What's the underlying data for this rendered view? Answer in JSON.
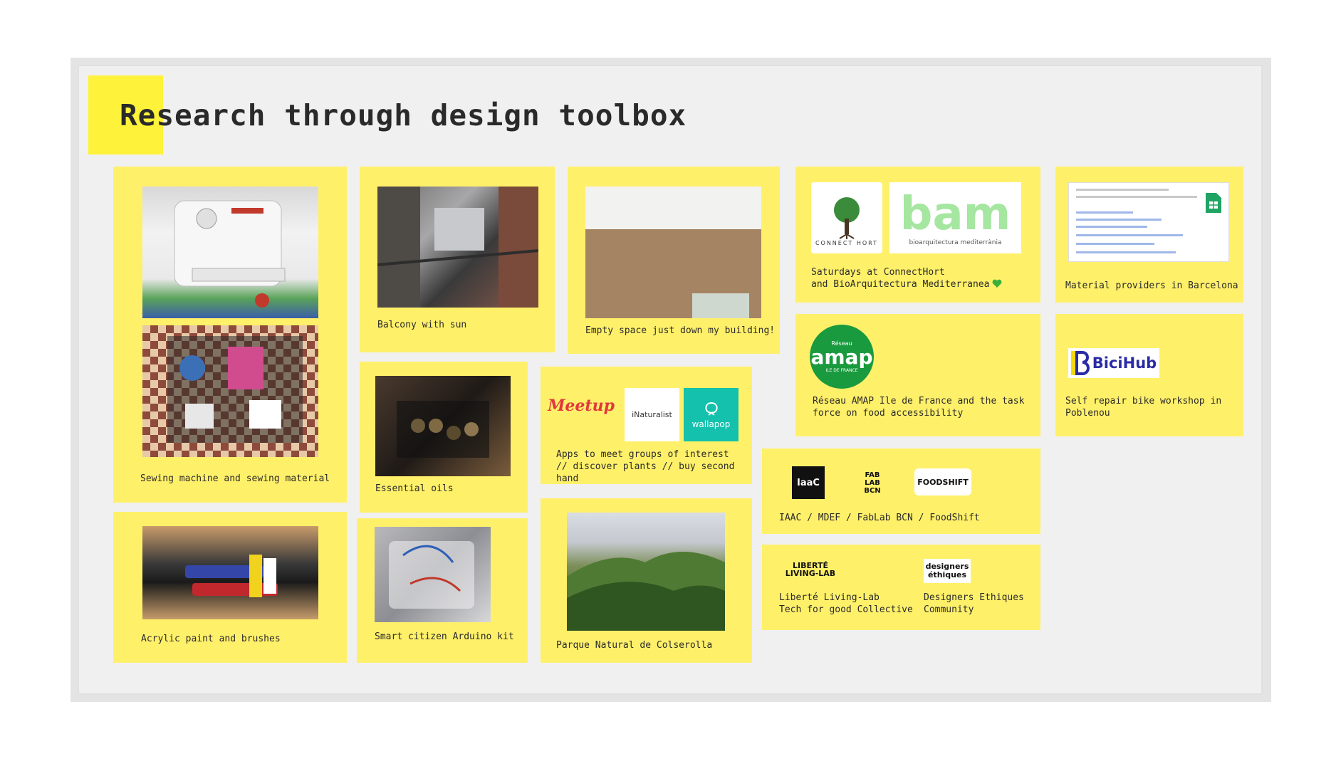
{
  "title": "Research through design toolbox",
  "colors": {
    "card": "#fff06a",
    "accent": "#fff23a",
    "board": "#f0f0f0"
  },
  "cards": {
    "sewing": {
      "caption": "Sewing machine and sewing material"
    },
    "acrylic": {
      "caption": "Acrylic paint and brushes"
    },
    "balcony": {
      "caption": "Balcony with sun"
    },
    "essential_oils": {
      "caption": "Essential oils"
    },
    "arduino": {
      "caption": "Smart citizen Arduino kit"
    },
    "empty_space": {
      "caption": "Empty space just down my building!"
    },
    "apps": {
      "caption": "Apps to meet groups of interest\n// discover plants // buy second\nhand",
      "logos": [
        "Meetup",
        "iNaturalist",
        "wallapop"
      ]
    },
    "colserolla": {
      "caption": "Parque Natural de Colserolla"
    },
    "connecthort": {
      "caption": "Saturdays at ConnectHort\nand BioArquitectura Mediterranea",
      "logos": [
        "CONNECT HORT",
        "bam",
        "bioarquitectura mediterrània"
      ]
    },
    "amap": {
      "caption": "Réseau AMAP Ile de France and the task\nforce on food accessibility",
      "logo": {
        "top": "Réseau",
        "main": "amap",
        "sub": "ILE DE FRANCE"
      }
    },
    "iaac": {
      "caption": "IAAC / MDEF / FabLab BCN / FoodShift",
      "logos": [
        "IaaC",
        "FAB LAB BCN",
        "FOODSHIFT"
      ]
    },
    "liberte": {
      "caption": "Liberté Living-Lab\nTech for good Collective",
      "logo": "LIBERTÉ LIVING-LAB"
    },
    "designers": {
      "caption": "Designers Ethiques\nCommunity",
      "logo": "designers éthiques"
    },
    "material": {
      "caption": "Material providers in Barcelona"
    },
    "bicihub": {
      "caption": "Self repair bike workshop in\nPoblenou",
      "logo": "BiciHub"
    }
  }
}
